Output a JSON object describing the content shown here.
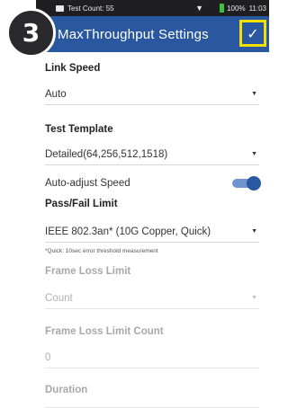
{
  "step_number": "3",
  "status_bar": {
    "title": "Test Count: 55",
    "battery_pct": "100%",
    "time": "11:03",
    "wifi_icon": "wifi-icon"
  },
  "app_bar": {
    "back_icon": "arrow-left-icon",
    "title": "MaxThroughput Settings",
    "confirm_icon": "checkmark-icon"
  },
  "form": {
    "link_speed": {
      "label": "Link Speed",
      "value": "Auto"
    },
    "test_template": {
      "label": "Test Template",
      "value": "Detailed(64,256,512,1518)"
    },
    "auto_adjust": {
      "label": "Auto-adjust Speed",
      "on": true
    },
    "pass_fail": {
      "label": "Pass/Fail Limit",
      "value": "IEEE 802.3an* (10G Copper, Quick)",
      "hint": "*Quick: 10sec error threshold measurement"
    },
    "frame_loss_limit": {
      "label": "Frame Loss Limit",
      "value": "Count"
    },
    "frame_loss_count": {
      "label": "Frame Loss Limit Count",
      "value": "0"
    },
    "duration": {
      "label": "Duration"
    }
  },
  "colors": {
    "app_bar": "#2a58a0",
    "highlight": "#f4e000",
    "toggle_on": "#2a58a0"
  }
}
